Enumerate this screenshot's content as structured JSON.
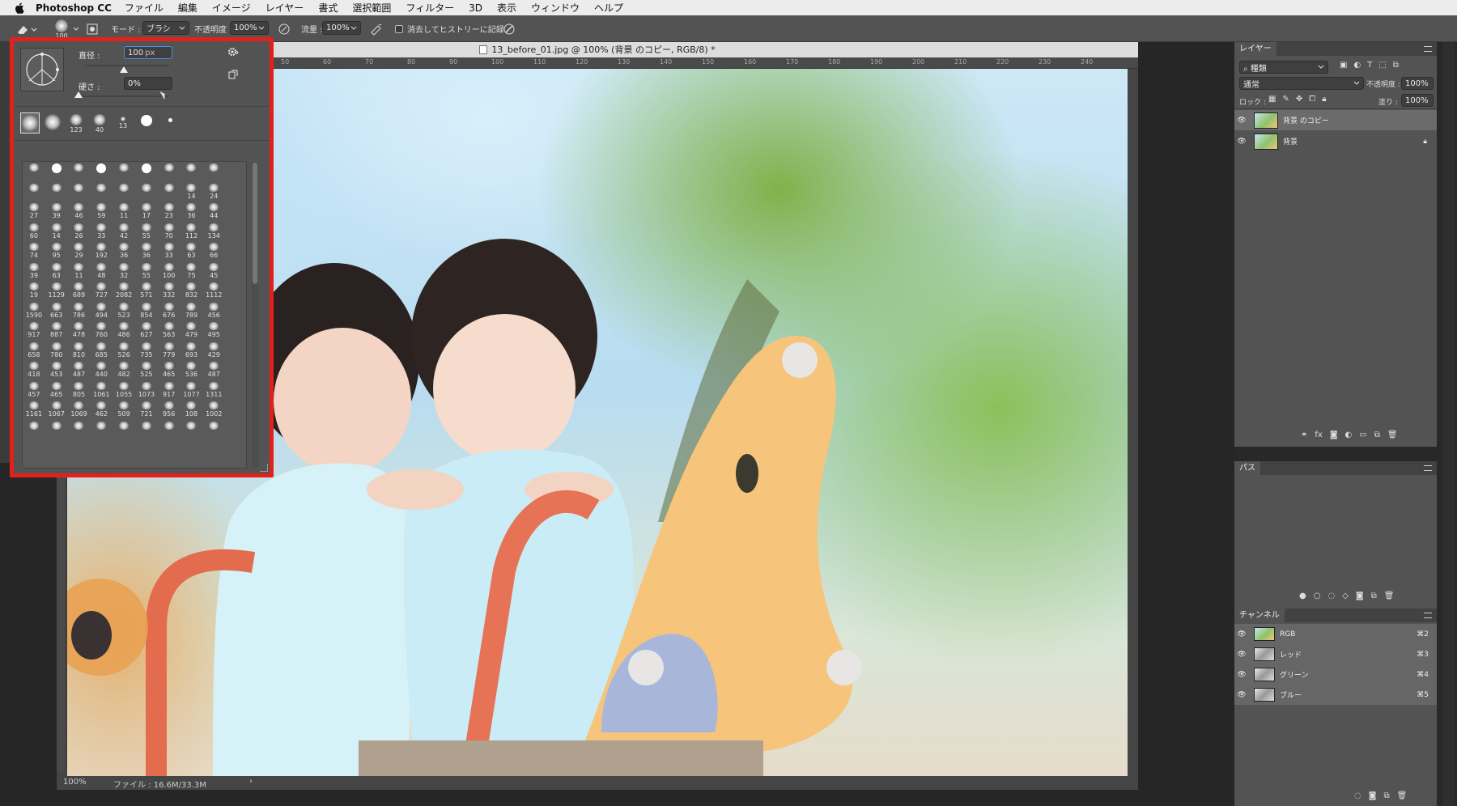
{
  "menubar": {
    "app_name": "Photoshop CC",
    "items": [
      "ファイル",
      "編集",
      "イメージ",
      "レイヤー",
      "書式",
      "選択範囲",
      "フィルター",
      "3D",
      "表示",
      "ウィンドウ",
      "ヘルプ"
    ]
  },
  "options": {
    "brush_size": "100",
    "mode_label": "モード :",
    "mode_value": "ブラシ",
    "opacity_label": "不透明度 :",
    "opacity_value": "100%",
    "flow_label": "流量 :",
    "flow_value": "100%",
    "history_label": "消去してヒストリーに記録"
  },
  "document": {
    "tab_title": "13_before_01.jpg @ 100% (背景 のコピー, RGB/8) *",
    "ruler_ticks": [
      "50",
      "60",
      "70",
      "80",
      "90",
      "100",
      "110",
      "120",
      "130",
      "140",
      "150",
      "160",
      "170",
      "180",
      "190",
      "200",
      "210",
      "220",
      "230",
      "240"
    ],
    "zoom": "100%",
    "file_info": "ファイル : 16.6M/33.3M",
    "status_arrow": "›"
  },
  "brush_panel": {
    "diameter_label": "直径 :",
    "diameter_value": "100",
    "diameter_unit": "px",
    "hardness_label": "硬さ :",
    "hardness_value": "0%",
    "recent_sizes": [
      "",
      "",
      "123",
      "40",
      "13",
      "",
      ""
    ],
    "grid": [
      [
        "",
        "",
        "",
        "",
        "",
        "",
        "",
        "",
        ""
      ],
      [
        "",
        "",
        "",
        "",
        "",
        "",
        "",
        "14",
        "24"
      ],
      [
        "27",
        "39",
        "46",
        "59",
        "11",
        "17",
        "23",
        "36",
        "44"
      ],
      [
        "60",
        "14",
        "26",
        "33",
        "42",
        "55",
        "70",
        "112",
        "134"
      ],
      [
        "74",
        "95",
        "29",
        "192",
        "36",
        "36",
        "33",
        "63",
        "66"
      ],
      [
        "39",
        "63",
        "11",
        "48",
        "32",
        "55",
        "100",
        "75",
        "45"
      ],
      [
        "19",
        "1129",
        "689",
        "727",
        "2082",
        "571",
        "332",
        "832",
        "1112"
      ],
      [
        "1590",
        "663",
        "786",
        "494",
        "523",
        "854",
        "676",
        "789",
        "456"
      ],
      [
        "917",
        "887",
        "478",
        "760",
        "486",
        "627",
        "563",
        "479",
        "495"
      ],
      [
        "658",
        "780",
        "810",
        "685",
        "526",
        "735",
        "779",
        "693",
        "429"
      ],
      [
        "418",
        "453",
        "487",
        "440",
        "482",
        "525",
        "465",
        "536",
        "487"
      ],
      [
        "457",
        "465",
        "805",
        "1061",
        "1055",
        "1073",
        "917",
        "1077",
        "1311"
      ],
      [
        "1161",
        "1067",
        "1069",
        "462",
        "509",
        "721",
        "956",
        "108",
        "1002"
      ],
      [
        "",
        "",
        "",
        "",
        "",
        "",
        "",
        "",
        ""
      ]
    ]
  },
  "layers_panel": {
    "tab": "レイヤー",
    "filter_kind": "種類",
    "blend_mode": "通常",
    "opacity_label": "不透明度 :",
    "opacity_value": "100%",
    "lock_label": "ロック :",
    "fill_label": "塗り :",
    "fill_value": "100%",
    "layers": [
      {
        "name": "背景 のコピー",
        "selected": true
      },
      {
        "name": "背景",
        "locked": true
      }
    ]
  },
  "paths_panel": {
    "tab": "パス"
  },
  "channels_panel": {
    "tab": "チャンネル",
    "channels": [
      {
        "name": "RGB",
        "shortcut": "⌘2"
      },
      {
        "name": "レッド",
        "shortcut": "⌘3"
      },
      {
        "name": "グリーン",
        "shortcut": "⌘4"
      },
      {
        "name": "ブルー",
        "shortcut": "⌘5"
      }
    ]
  },
  "colors": {
    "highlight": "#e3201b",
    "panel": "#535353",
    "selected_row": "#6b6b6b"
  }
}
